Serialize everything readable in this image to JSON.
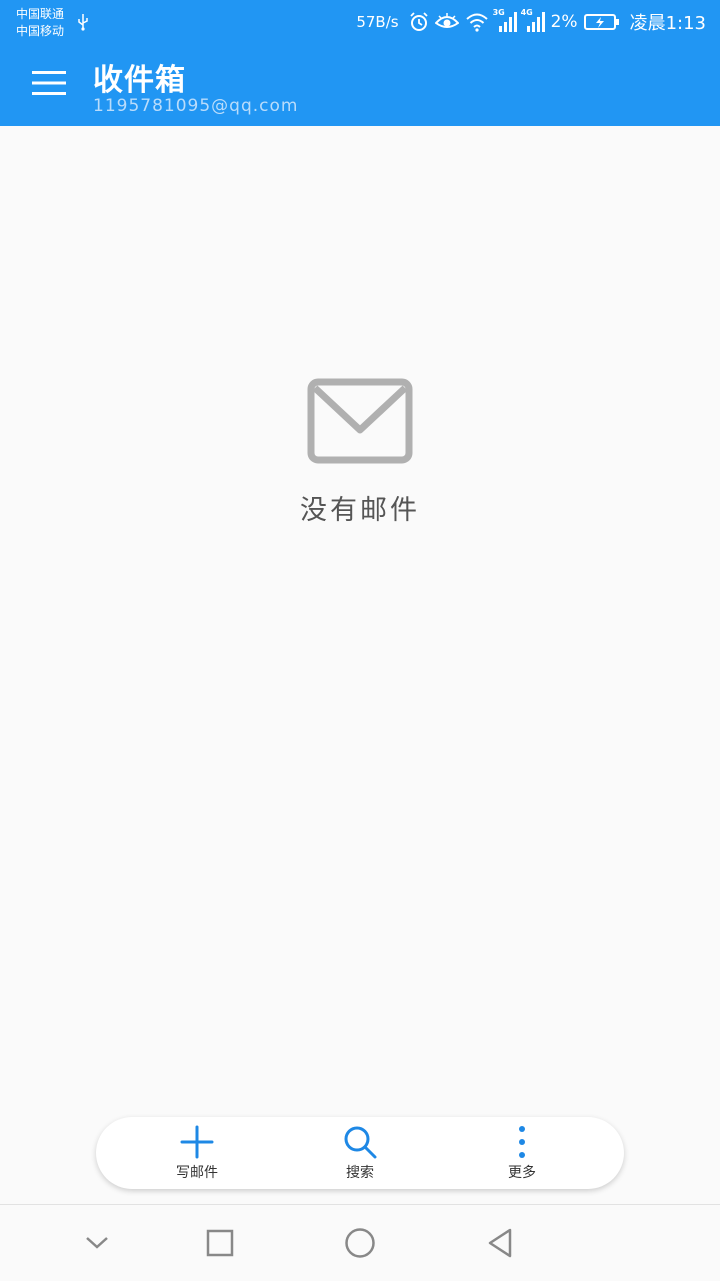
{
  "status_bar": {
    "carrier_1": "中国联通",
    "carrier_2": "中国移动",
    "net_speed": "57B/s",
    "signal_1_type": "3G",
    "signal_2_type": "4G",
    "battery": "2%",
    "time": "凌晨1:13",
    "icons": [
      "usb-icon",
      "alarm-icon",
      "eye-icon",
      "wifi-icon",
      "signal-icon",
      "battery-icon"
    ]
  },
  "toolbar": {
    "title": "收件箱",
    "account": "1195781095@qq.com",
    "menu_icon": "hamburger-menu-icon"
  },
  "empty_state": {
    "icon": "envelope-icon",
    "message": "没有邮件"
  },
  "actions": [
    {
      "label": "写邮件",
      "icon": "plus-icon"
    },
    {
      "label": "搜索",
      "icon": "search-icon"
    },
    {
      "label": "更多",
      "icon": "more-vertical-icon"
    }
  ],
  "nav_bar": {
    "icons": [
      "chevron-down-icon",
      "recent-apps-icon",
      "home-icon",
      "back-icon"
    ]
  },
  "colors": {
    "primary": "#2196f3",
    "accent": "#1e88e5",
    "background": "#fafafa",
    "empty_icon": "#b0b0b0"
  }
}
